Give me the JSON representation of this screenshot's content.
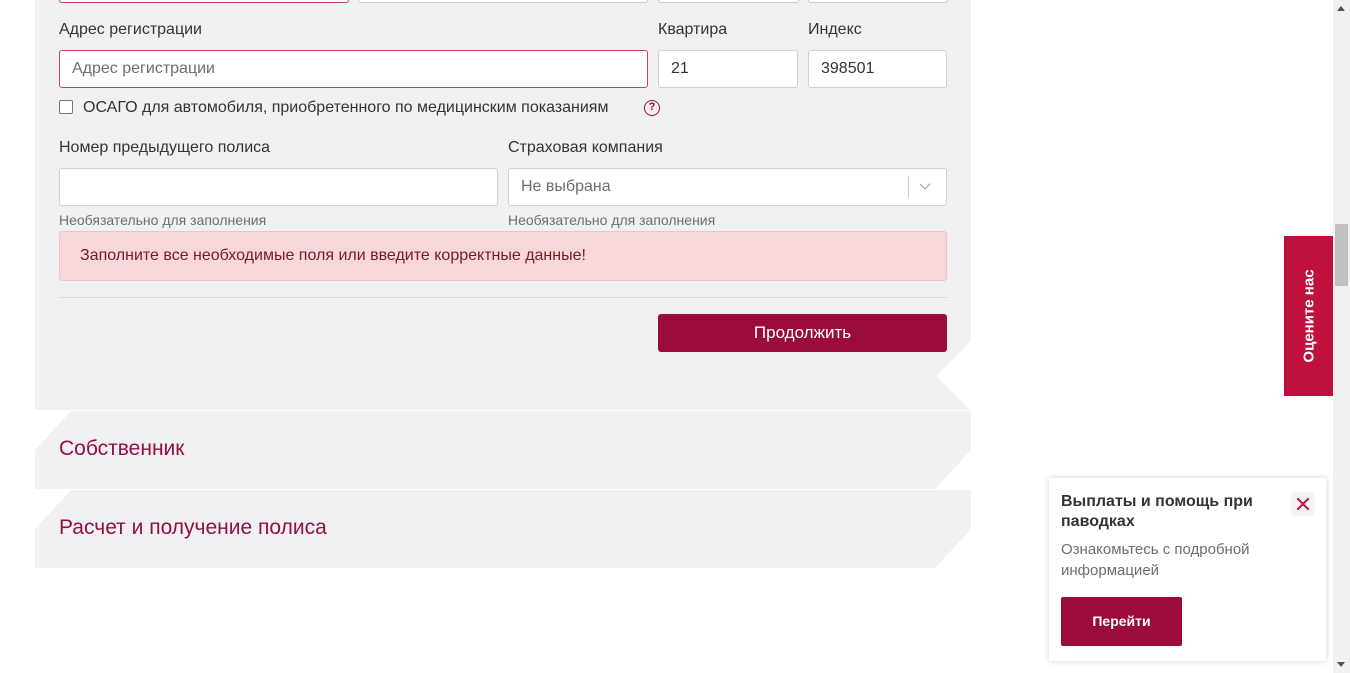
{
  "form": {
    "address_label": "Адрес регистрации",
    "address_placeholder": "Адрес регистрации",
    "apartment_label": "Квартира",
    "apartment_value": "21",
    "index_label": "Индекс",
    "index_value": "398501",
    "medical_checkbox_label": "ОСАГО для автомобиля, приобретенного по медицинским показаниям",
    "help_glyph": "?",
    "prev_policy_label": "Номер предыдущего полиса",
    "prev_policy_value": "",
    "prev_policy_hint": "Необязательно для заполнения",
    "insurer_label": "Страховая компания",
    "insurer_selected": "Не выбрана",
    "insurer_hint": "Необязательно для заполнения",
    "error_message": "Заполните все необходимые поля или введите корректные данные!",
    "continue_label": "Продолжить"
  },
  "sections": [
    {
      "title": "Собственник"
    },
    {
      "title": "Расчет и получение полиса"
    }
  ],
  "rate_tab": {
    "label": "Оцените нас"
  },
  "popup": {
    "title": "Выплаты и помощь при паводках",
    "text": "Ознакомьтесь с подробной информацией",
    "button_label": "Перейти"
  },
  "colors": {
    "brand": "#9b0c3a",
    "rate_tab": "#c0113e",
    "alert_bg": "#f8d7da",
    "panel_bg": "#f1f1f3"
  }
}
